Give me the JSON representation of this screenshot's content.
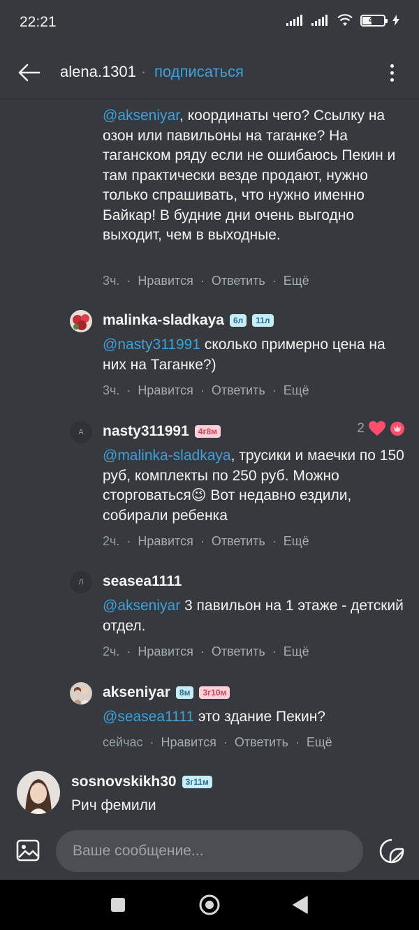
{
  "status_bar": {
    "time": "22:21",
    "battery": "40"
  },
  "header": {
    "username": "alena.1301",
    "separator": "·",
    "subscribe_label": "подписаться"
  },
  "comments": [
    {
      "mention": "@akseniyar",
      "text": ", координаты чего? Ссылку на озон или павильоны на таганке? На таганском ряду если не ошибаюсь Пекин и там практически везде продают, нужно только спрашивать, что нужно именно Байкар! В будние дни очень выгодно выходит, чем в выходные.",
      "time": "3ч.",
      "like_label": "Нравится",
      "reply_label": "Ответить",
      "more_label": "Ещё"
    },
    {
      "username": "malinka-sladkaya",
      "badges": [
        "6л",
        "11л"
      ],
      "mention": "@nasty311991",
      "text": " сколько примерно цена на них на Таганке?)",
      "time": "3ч.",
      "like_label": "Нравится",
      "reply_label": "Ответить",
      "more_label": "Ещё"
    },
    {
      "username": "nasty311991",
      "avatar_letter": "А",
      "badges": [
        "4г8м"
      ],
      "likes_count": "2",
      "mention": "@malinka-sladkaya",
      "text": ", трусики и маечки по 150 руб, комплекты по 250 руб. Можно сторговаться😉 Вот недавно ездили, собирали ребенка",
      "time": "2ч.",
      "like_label": "Нравится",
      "reply_label": "Ответить",
      "more_label": "Ещё"
    },
    {
      "username": "seasea1111",
      "avatar_letter": "Л",
      "mention": "@akseniyar",
      "text": " 3 павильон на 1 этаже - детский отдел.",
      "time": "2ч.",
      "like_label": "Нравится",
      "reply_label": "Ответить",
      "more_label": "Ещё"
    },
    {
      "username": "akseniyar",
      "badges": [
        "8м",
        "3г10м"
      ],
      "mention": "@seasea1111",
      "text": " это здание Пекин?",
      "time": "сейчас",
      "like_label": "Нравится",
      "reply_label": "Ответить",
      "more_label": "Ещё"
    }
  ],
  "bottom_comment": {
    "username": "sosnovskikh30",
    "badge": "3г11м",
    "text": "Рич фемили"
  },
  "input": {
    "placeholder": "Ваше сообщение..."
  },
  "colors": {
    "background": "#363a3e",
    "link": "#3fa0d8",
    "badge_blue_bg": "#c6eef9",
    "badge_pink_bg": "#ffd0d8",
    "heart": "#ff4d6d"
  }
}
